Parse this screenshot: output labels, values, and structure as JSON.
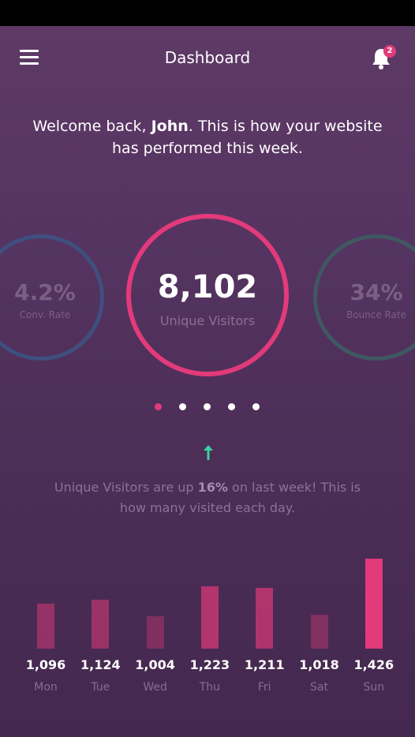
{
  "header": {
    "title": "Dashboard",
    "notification_count": "2"
  },
  "welcome": {
    "prefix": "Welcome back, ",
    "name": "John",
    "suffix": ". This is how your website has performed this week."
  },
  "metrics": {
    "left": {
      "value": "4.2%",
      "label": "Conv. Rate"
    },
    "main": {
      "value": "8,102",
      "label": "Unique Visitors"
    },
    "right": {
      "value": "34%",
      "label": "Bounce Rate"
    }
  },
  "carousel": {
    "total": 5,
    "active_index": 0
  },
  "trend": {
    "prefix": "Unique Visitors are up ",
    "percent": "16%",
    "suffix": " on last week! This is how many visited each day."
  },
  "colors": {
    "accent": "#e23a7a",
    "trend_up": "#3ad29f"
  },
  "chart_data": {
    "type": "bar",
    "categories": [
      "Mon",
      "Tue",
      "Wed",
      "Thu",
      "Fri",
      "Sat",
      "Sun"
    ],
    "values": [
      1096,
      1124,
      1004,
      1223,
      1211,
      1018,
      1426
    ],
    "value_labels": [
      "1,096",
      "1,124",
      "1,004",
      "1,223",
      "1,211",
      "1,018",
      "1,426"
    ],
    "title": "",
    "xlabel": "",
    "ylabel": ""
  }
}
